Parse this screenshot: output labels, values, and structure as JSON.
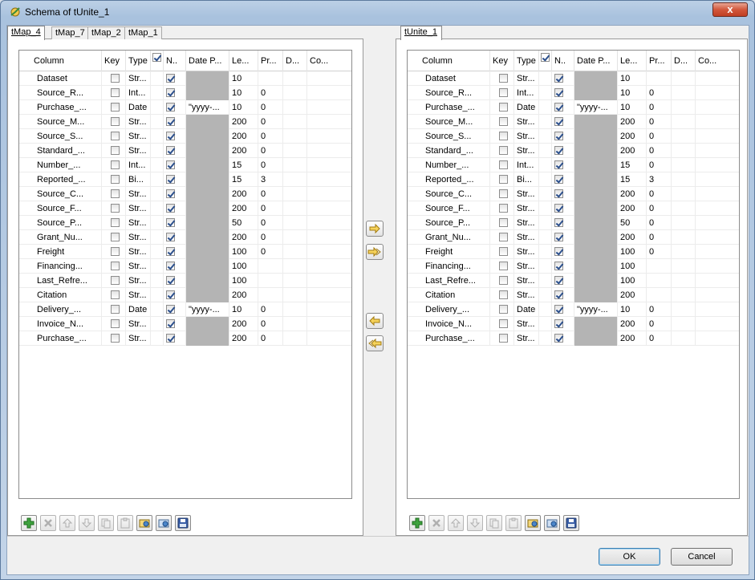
{
  "window": {
    "title": "Schema of tUnite_1",
    "close_label": "x"
  },
  "left": {
    "tabs": [
      "tMap_4",
      "tMap_7",
      "tMap_2",
      "tMap_1"
    ],
    "active_tab": 0
  },
  "right": {
    "tabs": [
      "tUnite_1"
    ],
    "active_tab": 0
  },
  "columns": {
    "column": "Column",
    "key": "Key",
    "type": "Type",
    "nullable": "N..",
    "date_pattern": "Date P...",
    "length": "Le...",
    "precision": "Pr...",
    "default": "D...",
    "comment": "Co..."
  },
  "rows": [
    {
      "name": "Dataset",
      "key": false,
      "type": "Str...",
      "nullable": true,
      "date": "",
      "len": "10",
      "prec": ""
    },
    {
      "name": "Source_R...",
      "key": false,
      "type": "Int...",
      "nullable": true,
      "date": "",
      "len": "10",
      "prec": "0"
    },
    {
      "name": "Purchase_...",
      "key": false,
      "type": "Date",
      "nullable": true,
      "date": "\"yyyy-...",
      "len": "10",
      "prec": "0"
    },
    {
      "name": "Source_M...",
      "key": false,
      "type": "Str...",
      "nullable": true,
      "date": "",
      "len": "200",
      "prec": "0"
    },
    {
      "name": "Source_S...",
      "key": false,
      "type": "Str...",
      "nullable": true,
      "date": "",
      "len": "200",
      "prec": "0"
    },
    {
      "name": "Standard_...",
      "key": false,
      "type": "Str...",
      "nullable": true,
      "date": "",
      "len": "200",
      "prec": "0"
    },
    {
      "name": "Number_...",
      "key": false,
      "type": "Int...",
      "nullable": true,
      "date": "",
      "len": "15",
      "prec": "0"
    },
    {
      "name": "Reported_...",
      "key": false,
      "type": "Bi...",
      "nullable": true,
      "date": "",
      "len": "15",
      "prec": "3"
    },
    {
      "name": "Source_C...",
      "key": false,
      "type": "Str...",
      "nullable": true,
      "date": "",
      "len": "200",
      "prec": "0"
    },
    {
      "name": "Source_F...",
      "key": false,
      "type": "Str...",
      "nullable": true,
      "date": "",
      "len": "200",
      "prec": "0"
    },
    {
      "name": "Source_P...",
      "key": false,
      "type": "Str...",
      "nullable": true,
      "date": "",
      "len": "50",
      "prec": "0"
    },
    {
      "name": "Grant_Nu...",
      "key": false,
      "type": "Str...",
      "nullable": true,
      "date": "",
      "len": "200",
      "prec": "0"
    },
    {
      "name": "Freight",
      "key": false,
      "type": "Str...",
      "nullable": true,
      "date": "",
      "len": "100",
      "prec": "0"
    },
    {
      "name": "Financing...",
      "key": false,
      "type": "Str...",
      "nullable": true,
      "date": "",
      "len": "100",
      "prec": ""
    },
    {
      "name": "Last_Refre...",
      "key": false,
      "type": "Str...",
      "nullable": true,
      "date": "",
      "len": "100",
      "prec": ""
    },
    {
      "name": "Citation",
      "key": false,
      "type": "Str...",
      "nullable": true,
      "date": "",
      "len": "200",
      "prec": ""
    },
    {
      "name": "Delivery_...",
      "key": false,
      "type": "Date",
      "nullable": true,
      "date": "\"yyyy-...",
      "len": "10",
      "prec": "0"
    },
    {
      "name": "Invoice_N...",
      "key": false,
      "type": "Str...",
      "nullable": true,
      "date": "",
      "len": "200",
      "prec": "0"
    },
    {
      "name": "Purchase_...",
      "key": false,
      "type": "Str...",
      "nullable": true,
      "date": "",
      "len": "200",
      "prec": "0"
    }
  ],
  "toolbar_icons": [
    "add-icon",
    "remove-icon",
    "move-up-icon",
    "move-down-icon",
    "copy-icon",
    "paste-icon",
    "import-icon",
    "export-icon",
    "save-icon"
  ],
  "footer": {
    "ok_label": "OK",
    "cancel_label": "Cancel"
  }
}
